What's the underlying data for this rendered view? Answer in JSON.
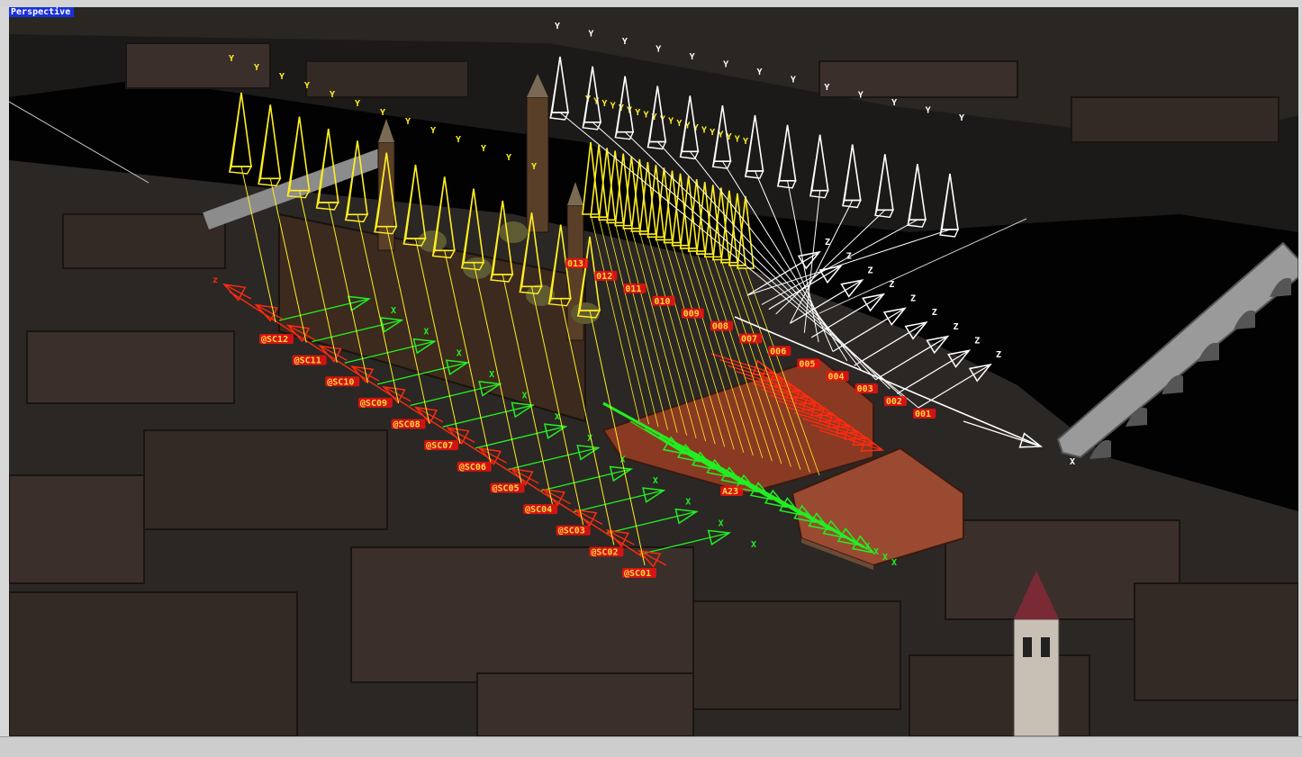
{
  "viewport": {
    "label": "Perspective"
  },
  "colors": {
    "ground": "#1c1a18",
    "river": "#020202",
    "yellow_cams": "#ffee22",
    "white_cams": "#ffffff",
    "red_cams": "#ff2a10",
    "green_cams": "#22ee22",
    "label_fill": "#f01010",
    "label_text": "#ffd840",
    "bridge": "#9a9a9a",
    "roof": "#8a3a22"
  },
  "scene_objects": {
    "cathedral": "basilica-model",
    "bridge": "stone-bridge-model",
    "tower": "bell-tower-model"
  },
  "axis_letters": {
    "up": "Y",
    "forward": "Z",
    "side": "X"
  },
  "camera_groups": {
    "white_path": [
      "001",
      "002",
      "003",
      "004",
      "005",
      "006",
      "007",
      "008",
      "009",
      "010",
      "011",
      "012",
      "013"
    ],
    "red_path": [
      "@SC01",
      "@SC02",
      "@SC03",
      "@SC04",
      "@SC05",
      "@SC06",
      "@SC07",
      "@SC08",
      "@SC09",
      "@SC10",
      "@SC11",
      "@SC12"
    ],
    "facade_path": [
      "A23"
    ]
  }
}
